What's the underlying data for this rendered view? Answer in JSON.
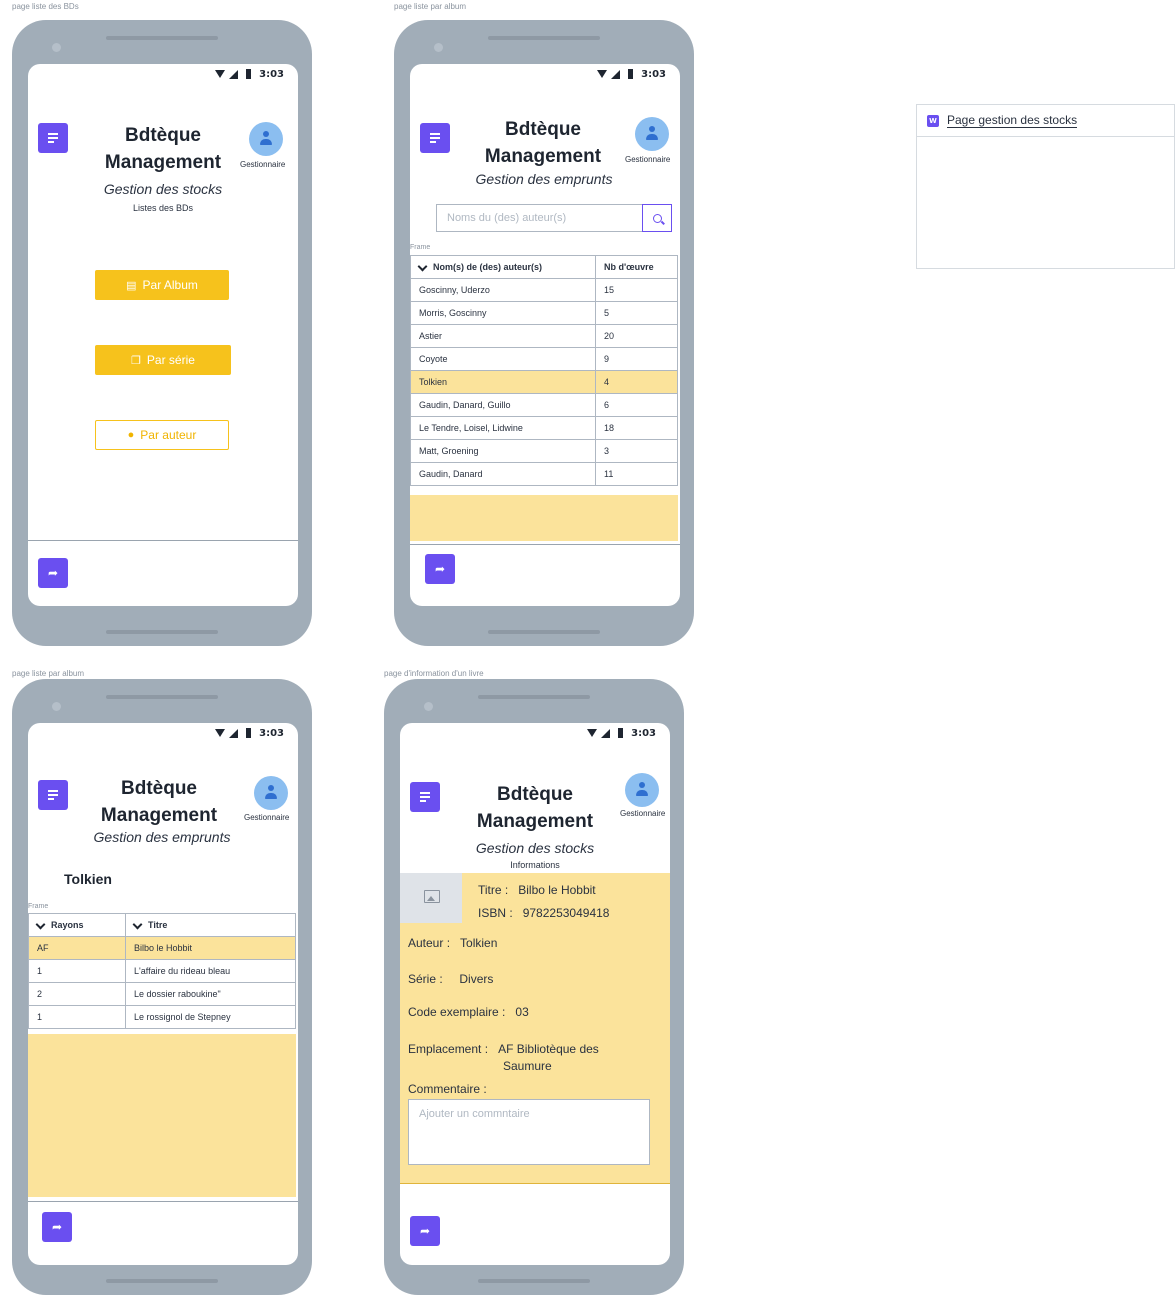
{
  "frames": {
    "f1_label": "page liste des BDs",
    "f2_label": "page liste par album",
    "f3_label": "page liste par album",
    "f4_label": "page d'information d'un livre"
  },
  "common": {
    "time": "3:03",
    "title_line1": "Bdtèque",
    "title_line2": "Management",
    "avatar_label": "Gestionnaire",
    "frame_tag": "Frame"
  },
  "screen1": {
    "subtitle": "Gestion des stocks",
    "section": "Listes des BDs",
    "btn_album": "Par Album",
    "btn_serie": "Par série",
    "btn_auteur": "Par auteur"
  },
  "screen2": {
    "subtitle": "Gestion des emprunts",
    "search_placeholder": "Noms du (des) auteur(s)",
    "col_author": "Nom(s) de (des) auteur(s)",
    "col_count": "Nb d'œuvre",
    "rows": [
      {
        "author": "Goscinny, Uderzo",
        "count": "15"
      },
      {
        "author": "Morris, Goscinny",
        "count": "5"
      },
      {
        "author": "Astier",
        "count": "20"
      },
      {
        "author": "Coyote",
        "count": "9"
      },
      {
        "author": "Tolkien",
        "count": "4"
      },
      {
        "author": "Gaudin, Danard, Guillo",
        "count": "6"
      },
      {
        "author": "Le Tendre, Loisel, Lidwine",
        "count": "18"
      },
      {
        "author": "Matt, Groening",
        "count": "3"
      },
      {
        "author": "Gaudin, Danard",
        "count": "11"
      }
    ]
  },
  "screen3": {
    "subtitle": "Gestion des emprunts",
    "author_heading": "Tolkien",
    "col_rayons": "Rayons",
    "col_titre": "Titre",
    "rows": [
      {
        "rayon": "AF",
        "titre": "Bilbo le Hobbit"
      },
      {
        "rayon": "1",
        "titre": "L'affaire du rideau bleau"
      },
      {
        "rayon": "2",
        "titre": "Le dossier raboukine\""
      },
      {
        "rayon": "1",
        "titre": "Le rossignol de Stepney"
      }
    ]
  },
  "screen4": {
    "subtitle": "Gestion des stocks",
    "section": "Informations",
    "titre_label": "Titre :",
    "titre_value": "Bilbo le Hobbit",
    "isbn_label": "ISBN :",
    "isbn_value": "9782253049418",
    "auteur_label": "Auteur :",
    "auteur_value": "Tolkien",
    "serie_label": "Série :",
    "serie_value": "Divers",
    "code_label": "Code exemplaire :",
    "code_value": "03",
    "emplacement_label": "Emplacement :",
    "emplacement_value_1": "AF Bibliotèque des",
    "emplacement_value_2": "Saumure",
    "commentaire_label": "Commentaire :",
    "commentaire_placeholder": "Ajouter un commntaire"
  },
  "stock_card": {
    "badge": "W",
    "title": "Page gestion des stocks"
  },
  "colors": {
    "accent": "#6a4ff0",
    "highlight": "#fbe39b",
    "button_yellow": "#f6c21c",
    "phone_frame": "#a1adb8"
  }
}
